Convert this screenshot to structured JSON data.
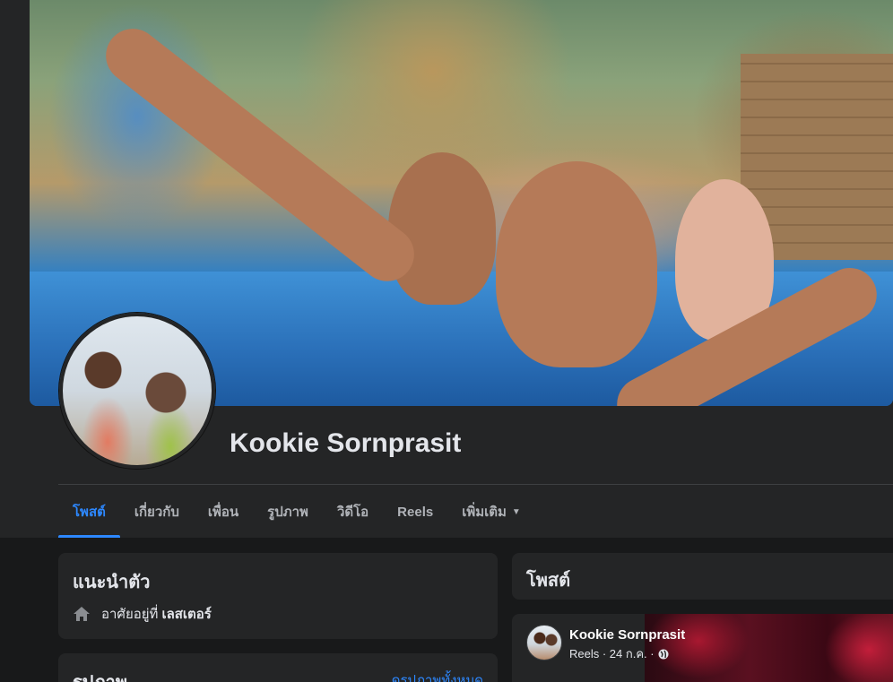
{
  "profile": {
    "name": "Kookie Sornprasit"
  },
  "tabs": [
    {
      "label": "โพสต์",
      "active": true
    },
    {
      "label": "เกี่ยวกับ"
    },
    {
      "label": "เพื่อน"
    },
    {
      "label": "รูปภาพ"
    },
    {
      "label": "วิดีโอ"
    },
    {
      "label": "Reels"
    },
    {
      "label": "เพิ่มเติม"
    }
  ],
  "intro": {
    "title": "แนะนำตัว",
    "lives_prefix": "อาศัยอยู่ที่",
    "lives_place": "เลสเตอร์",
    "icon": "home-icon"
  },
  "photos": {
    "title": "รูปภาพ",
    "see_all": "ดูรูปภาพทั้งหมด"
  },
  "posts": {
    "title": "โพสต์"
  },
  "post": {
    "author": "Kookie Sornprasit",
    "meta": "Reels · 24 ก.ค. ·",
    "privacy_icon": "globe-icon"
  },
  "colors": {
    "accent": "#2d88ff",
    "background": "#18191a",
    "card": "#242526"
  }
}
